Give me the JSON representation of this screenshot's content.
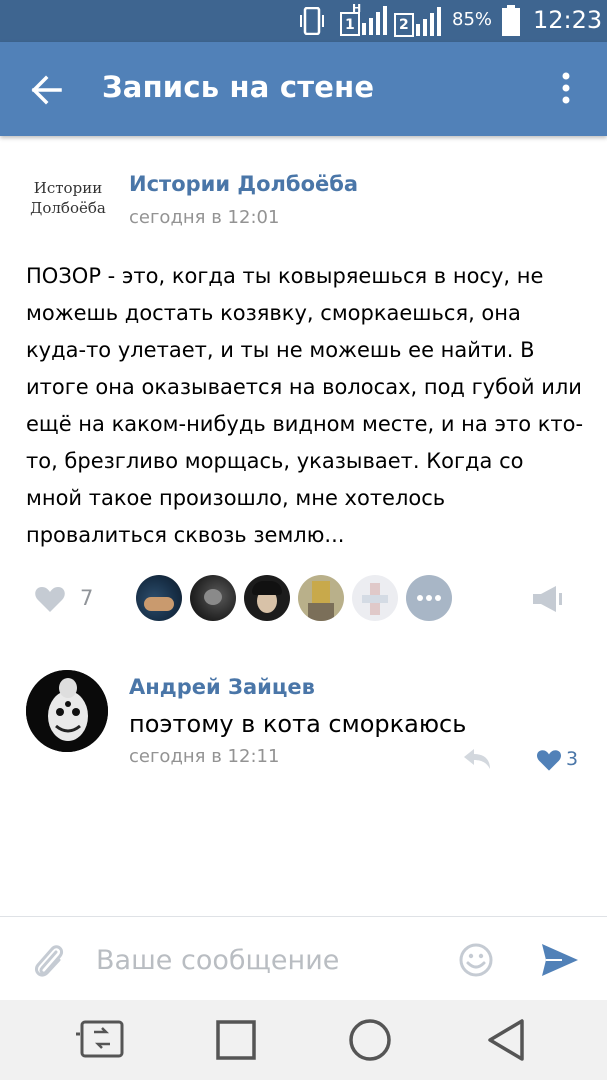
{
  "status_bar": {
    "network_1_label": "H",
    "network_1_sim": "1",
    "network_2_sim": "2",
    "battery_percent": "85%",
    "time": "12:23"
  },
  "app_bar": {
    "title": "Запись на стене",
    "back_icon": "arrow-left-icon",
    "menu_icon": "more-vertical-icon"
  },
  "post": {
    "logo_line1": "Истории",
    "logo_line2": "Долбоёба",
    "author": "Истории Долбоёба",
    "time": "сегодня в 12:01",
    "text": "ПОЗОР - это, когда ты ковыряешься в носу, не можешь достать козявку, сморкаешься, она куда-то улетает, и ты не можешь ее найти. В итоге она оказывается на волосах, под губой или ещё на каком-нибудь видном месте, и на это кто-то, брезгливо морщась, указывает. Когда со мной такое произошло, мне хотелось провалиться сквозь землю...",
    "likes_count": "7",
    "liker_count_shown": 5
  },
  "comment": {
    "author": "Андрей Зайцев",
    "text": "поэтому в кота сморкаюсь",
    "time": "сегодня в 12:11",
    "likes_count": "3"
  },
  "input_bar": {
    "placeholder": "Ваше сообщение",
    "value": ""
  },
  "colors": {
    "status_bar": "#3e6590",
    "app_bar": "#5181b8",
    "link_blue": "#4a76a8",
    "meta_gray": "#939393"
  }
}
